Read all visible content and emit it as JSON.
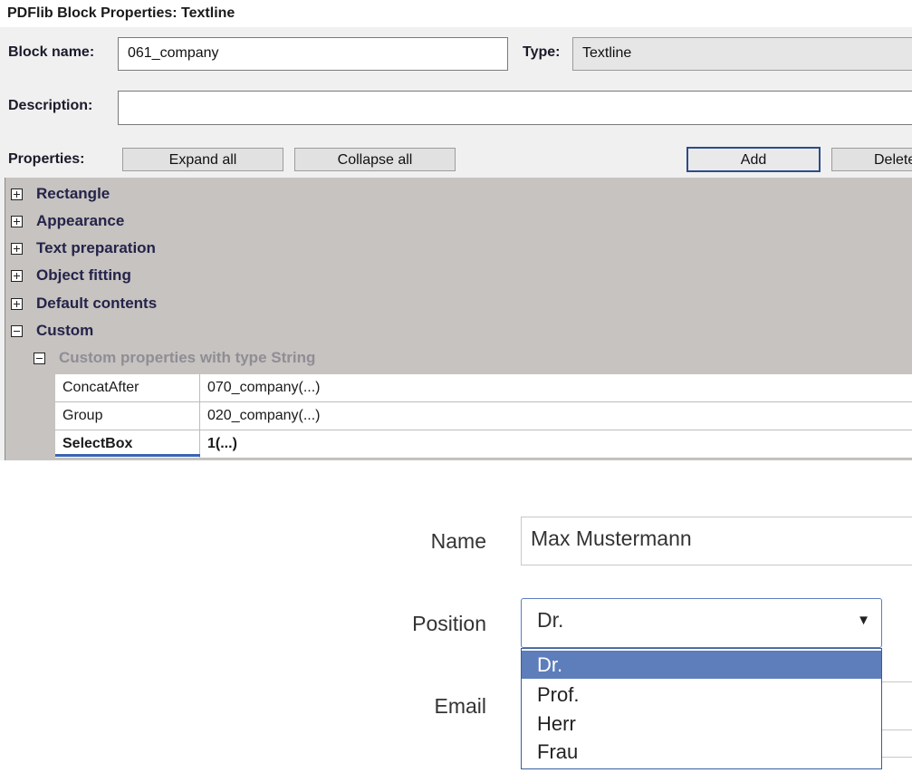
{
  "dialog": {
    "title": "PDFlib Block Properties: Textline",
    "block_name_label": "Block name:",
    "block_name_value": "061_company",
    "type_label": "Type:",
    "type_value": "Textline",
    "description_label": "Description:",
    "description_value": "",
    "properties_label": "Properties:",
    "buttons": {
      "expand_all": "Expand all",
      "collapse_all": "Collapse all",
      "add": "Add",
      "delete": "Delete"
    },
    "tree": {
      "categories": [
        {
          "label": "Rectangle",
          "expanded": false
        },
        {
          "label": "Appearance",
          "expanded": false
        },
        {
          "label": "Text preparation",
          "expanded": false
        },
        {
          "label": "Object fitting",
          "expanded": false
        },
        {
          "label": "Default contents",
          "expanded": false
        },
        {
          "label": "Custom",
          "expanded": true
        }
      ],
      "subcategory": "Custom properties with type String",
      "rows": [
        {
          "key": "ConcatAfter",
          "value": "070_company(...)",
          "selected": false
        },
        {
          "key": "Group",
          "value": "020_company(...)",
          "selected": false
        },
        {
          "key": "SelectBox",
          "value": "1(...)",
          "selected": true
        }
      ]
    }
  },
  "form": {
    "name_label": "Name",
    "name_value": "Max Mustermann",
    "position_label": "Position",
    "position_value": "Dr.",
    "email_label": "Email",
    "options": [
      "Dr.",
      "Prof.",
      "Herr",
      "Frau"
    ],
    "selected_option_index": 0,
    "caret": "▼"
  },
  "colors": {
    "tree_background": "#c6c3c0",
    "selected_option": "#5d7dbb",
    "category_text": "#25234a"
  }
}
